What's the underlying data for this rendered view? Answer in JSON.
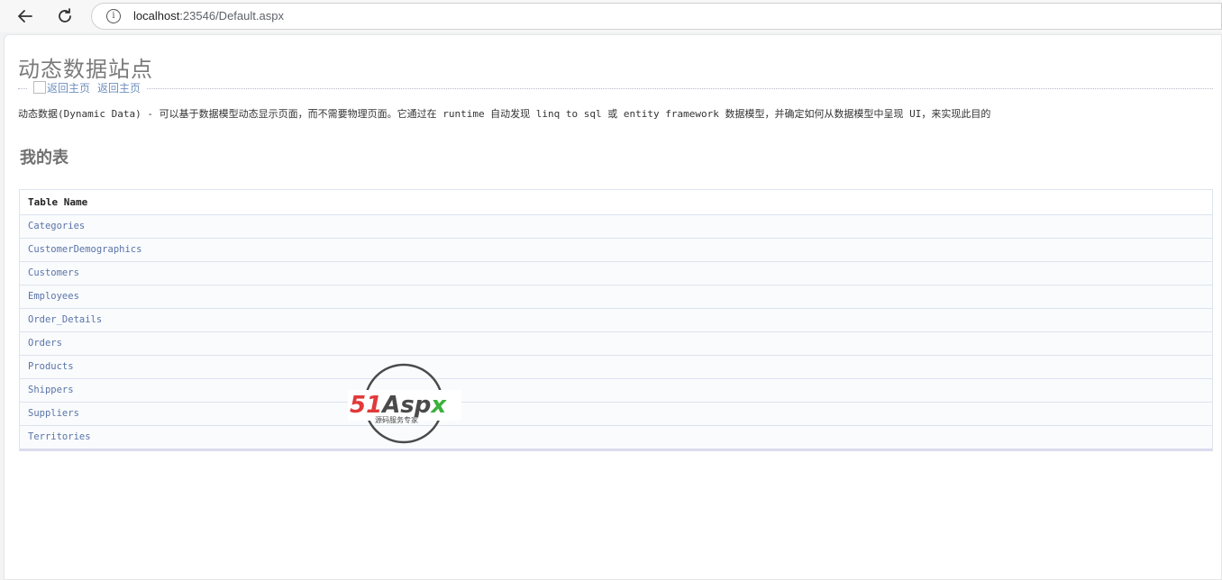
{
  "browser": {
    "url_host": "localhost",
    "url_rest": ":23546/Default.aspx",
    "info_icon": "i"
  },
  "page": {
    "site_title": "动态数据站点",
    "home_link_img_alt": "返回主页",
    "home_link_text": "返回主页",
    "description": "动态数据(Dynamic Data) - 可以基于数据模型动态显示页面，而不需要物理页面。它通过在 runtime 自动发现 linq to sql 或 entity framework 数据模型，并确定如何从数据模型中呈现 UI，来实现此目的",
    "section_title": "我的表"
  },
  "grid": {
    "header": "Table Name",
    "rows": [
      "Categories",
      "CustomerDemographics",
      "Customers",
      "Employees",
      "Order_Details",
      "Orders",
      "Products",
      "Shippers",
      "Suppliers",
      "Territories"
    ]
  },
  "watermark": {
    "brand_red": "51",
    "brand_dark": "Asp",
    "brand_green": "x",
    "tagline": "源码服务专家",
    "colors": {
      "red": "#e03a3a",
      "dark": "#4a4a4a",
      "green": "#3db03d"
    }
  }
}
